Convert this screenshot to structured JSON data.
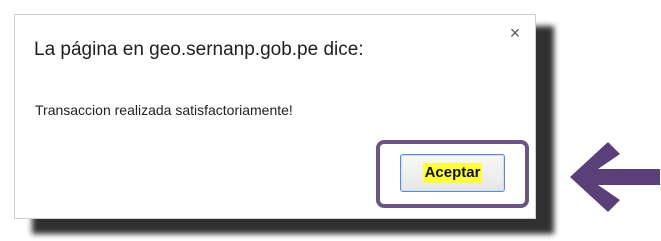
{
  "dialog": {
    "title": "La página en geo.sernanp.gob.pe dice:",
    "close_icon": "close-icon",
    "message": "Transaccion realizada satisfactoriamente!",
    "accept_label": "Aceptar"
  },
  "annotation": {
    "frame_color": "#6b5586",
    "arrow_color": "#5a3f79",
    "highlight_color": "#ffff3a",
    "arrow_icon": "arrow-left-icon"
  }
}
